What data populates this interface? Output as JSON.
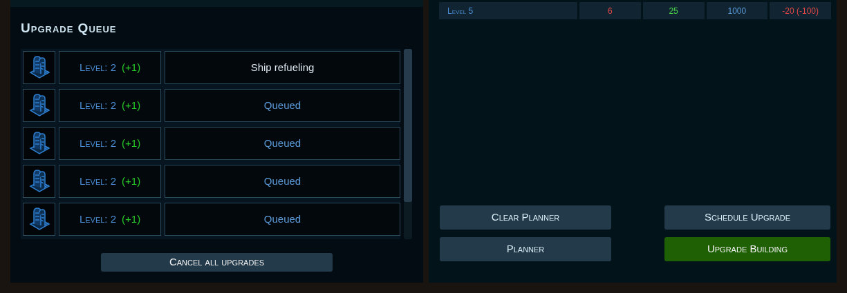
{
  "upgrade_queue": {
    "title": "Upgrade Queue",
    "items": [
      {
        "level": "Level: 2",
        "delta": "(+1)",
        "status": "Ship refueling",
        "active": true
      },
      {
        "level": "Level: 2",
        "delta": "(+1)",
        "status": "Queued",
        "active": false
      },
      {
        "level": "Level: 2",
        "delta": "(+1)",
        "status": "Queued",
        "active": false
      },
      {
        "level": "Level: 2",
        "delta": "(+1)",
        "status": "Queued",
        "active": false
      },
      {
        "level": "Level: 2",
        "delta": "(+1)",
        "status": "Queued",
        "active": false
      }
    ],
    "cancel_button": "Cancel all upgrades"
  },
  "level_table": {
    "rows": [
      {
        "label": "Level 5",
        "cells": [
          {
            "text": "6",
            "color": "#e84848"
          },
          {
            "text": "25",
            "color": "#4cd84c"
          },
          {
            "text": "1000",
            "color": "#5b9ad8"
          },
          {
            "text": "-20 (-100)",
            "color": "#e84848"
          }
        ]
      }
    ]
  },
  "buttons": [
    {
      "label": "Clear Planner",
      "kind": "default"
    },
    {
      "label": "Schedule Upgrade",
      "kind": "default"
    },
    {
      "label": "Planner",
      "kind": "default"
    },
    {
      "label": "Upgrade Building",
      "kind": "confirm"
    }
  ]
}
